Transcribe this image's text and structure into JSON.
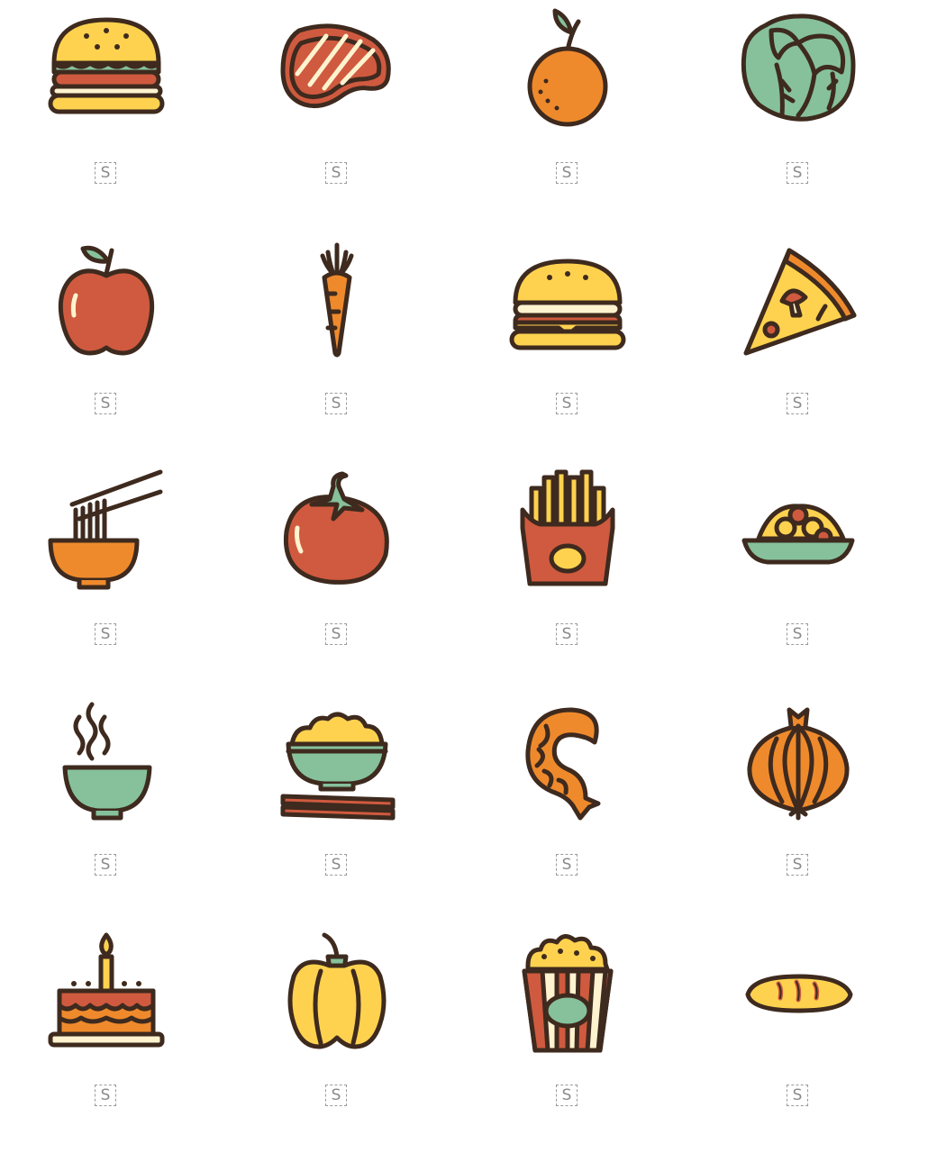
{
  "badge_text": "S",
  "colors": {
    "outline": "#3e2a1e",
    "yellow": "#fed24f",
    "orange": "#ef8a2c",
    "red": "#cf5a3f",
    "green": "#86c19b",
    "cream": "#fff3cf"
  },
  "icons": [
    {
      "name": "burger-icon",
      "badge": "S"
    },
    {
      "name": "steak-icon",
      "badge": "S"
    },
    {
      "name": "orange-icon",
      "badge": "S"
    },
    {
      "name": "cabbage-icon",
      "badge": "S"
    },
    {
      "name": "apple-icon",
      "badge": "S"
    },
    {
      "name": "carrot-icon",
      "badge": "S"
    },
    {
      "name": "cheeseburger-icon",
      "badge": "S"
    },
    {
      "name": "pizza-slice-icon",
      "badge": "S"
    },
    {
      "name": "noodle-bowl-icon",
      "badge": "S"
    },
    {
      "name": "tomato-icon",
      "badge": "S"
    },
    {
      "name": "french-fries-icon",
      "badge": "S"
    },
    {
      "name": "spaghetti-plate-icon",
      "badge": "S"
    },
    {
      "name": "hot-soup-icon",
      "badge": "S"
    },
    {
      "name": "rice-bowl-icon",
      "badge": "S"
    },
    {
      "name": "shrimp-icon",
      "badge": "S"
    },
    {
      "name": "onion-icon",
      "badge": "S"
    },
    {
      "name": "birthday-cake-icon",
      "badge": "S"
    },
    {
      "name": "bell-pepper-icon",
      "badge": "S"
    },
    {
      "name": "popcorn-icon",
      "badge": "S"
    },
    {
      "name": "bread-loaf-icon",
      "badge": "S"
    }
  ]
}
